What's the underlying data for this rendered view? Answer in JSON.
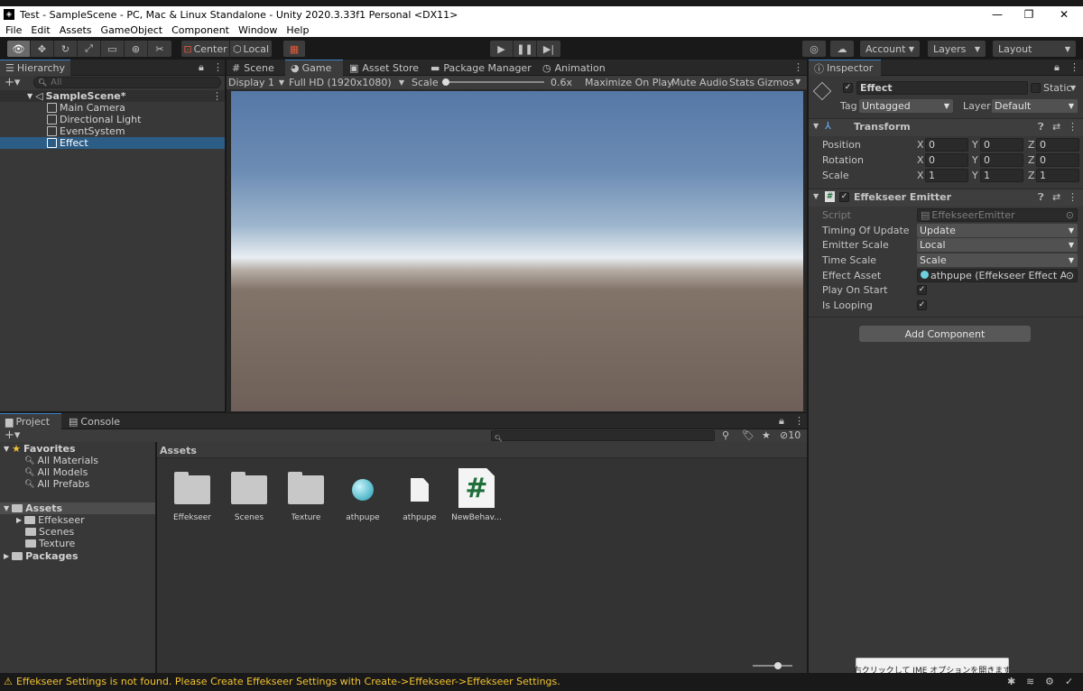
{
  "window": {
    "title": "Test - SampleScene - PC, Mac & Linux Standalone - Unity 2020.3.33f1 Personal <DX11>"
  },
  "menu": [
    "File",
    "Edit",
    "Assets",
    "GameObject",
    "Component",
    "Window",
    "Help"
  ],
  "toolbar": {
    "center": "Center",
    "local": "Local",
    "account": "Account",
    "layers": "Layers",
    "layout": "Layout"
  },
  "hierarchy": {
    "tab": "Hierarchy",
    "search_placeholder": "All",
    "scene": "SampleScene*",
    "items": [
      "Main Camera",
      "Directional Light",
      "EventSystem",
      "Effect"
    ],
    "selected": "Effect"
  },
  "center_tabs": [
    "Scene",
    "Game",
    "Asset Store",
    "Package Manager",
    "Animation"
  ],
  "game": {
    "display": "Display 1",
    "resolution": "Full HD (1920x1080)",
    "scale_label": "Scale",
    "scale_value": "0.6x",
    "maximize": "Maximize On Play",
    "mute": "Mute Audio",
    "stats": "Stats",
    "gizmos": "Gizmos"
  },
  "inspector": {
    "tab": "Inspector",
    "object_name": "Effect",
    "static_label": "Static",
    "tag_label": "Tag",
    "tag_value": "Untagged",
    "layer_label": "Layer",
    "layer_value": "Default",
    "transform": {
      "title": "Transform",
      "rows": [
        {
          "label": "Position",
          "x": "0",
          "y": "0",
          "z": "0"
        },
        {
          "label": "Rotation",
          "x": "0",
          "y": "0",
          "z": "0"
        },
        {
          "label": "Scale",
          "x": "1",
          "y": "1",
          "z": "1"
        }
      ]
    },
    "emitter": {
      "title": "Effekseer Emitter",
      "script_label": "Script",
      "script_value": "EffekseerEmitter",
      "timing_label": "Timing Of Update",
      "timing_value": "Update",
      "emitter_scale_label": "Emitter Scale",
      "emitter_scale_value": "Local",
      "time_scale_label": "Time Scale",
      "time_scale_value": "Scale",
      "effect_asset_label": "Effect Asset",
      "effect_asset_value": "athpupe (Effekseer Effect Asset",
      "play_on_start_label": "Play On Start",
      "is_looping_label": "Is Looping"
    },
    "add_component": "Add Component",
    "ime_tooltip": "右クリックして IME オプションを開きます"
  },
  "project": {
    "tabs": [
      "Project",
      "Console"
    ],
    "favorites_label": "Favorites",
    "favorites": [
      "All Materials",
      "All Models",
      "All Prefabs"
    ],
    "assets_label": "Assets",
    "asset_folders": [
      "Effekseer",
      "Scenes",
      "Texture"
    ],
    "packages_label": "Packages",
    "breadcrumb": "Assets",
    "hidden_count": "10",
    "grid": [
      "Effekseer",
      "Scenes",
      "Texture",
      "athpupe",
      "athpupe",
      "NewBehav..."
    ]
  },
  "status": {
    "message": "Effekseer Settings is not found. Please Create Effekseer Settings with Create->Effekseer->Effekseer Settings.",
    "color": "#f4c430"
  },
  "colors": {
    "accent": "#3d82c6",
    "selected_row": "#2c5d87"
  }
}
